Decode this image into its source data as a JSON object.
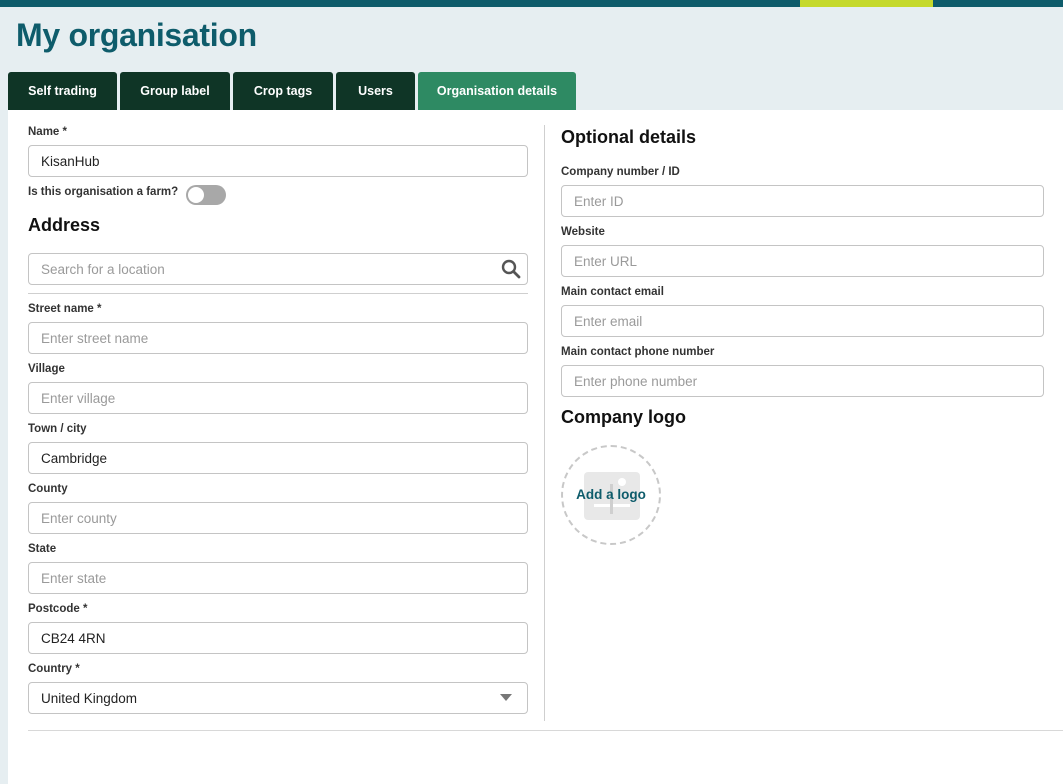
{
  "header": {
    "title": "My organisation"
  },
  "tabs": [
    {
      "label": "Self trading"
    },
    {
      "label": "Group label"
    },
    {
      "label": "Crop tags"
    },
    {
      "label": "Users"
    },
    {
      "label": "Organisation details",
      "active": true
    }
  ],
  "form": {
    "name": {
      "label": "Name *",
      "value": "KisanHub"
    },
    "farm_toggle": {
      "label": "Is this organisation a farm?",
      "on": false
    },
    "address_heading": "Address",
    "search": {
      "placeholder": "Search for a location"
    },
    "street": {
      "label": "Street name *",
      "placeholder": "Enter street name",
      "value": ""
    },
    "village": {
      "label": "Village",
      "placeholder": "Enter village",
      "value": ""
    },
    "town": {
      "label": "Town / city",
      "placeholder": "",
      "value": "Cambridge"
    },
    "county": {
      "label": "County",
      "placeholder": "Enter county",
      "value": ""
    },
    "state": {
      "label": "State",
      "placeholder": "Enter state",
      "value": ""
    },
    "postcode": {
      "label": "Postcode *",
      "value": "CB24 4RN"
    },
    "country": {
      "label": "Country *",
      "value": "United Kingdom"
    }
  },
  "optional": {
    "heading": "Optional details",
    "company_number": {
      "label": "Company number / ID",
      "placeholder": "Enter ID"
    },
    "website": {
      "label": "Website",
      "placeholder": "Enter URL"
    },
    "email": {
      "label": "Main contact email",
      "placeholder": "Enter email"
    },
    "phone": {
      "label": "Main contact phone number",
      "placeholder": "Enter phone number"
    },
    "logo_heading": "Company logo",
    "logo_button": "Add a logo"
  },
  "colors": {
    "brand": "#0e5c6b",
    "accent": "#c5d92c",
    "tab": "#0f3526",
    "tab_active": "#2e8a63"
  }
}
